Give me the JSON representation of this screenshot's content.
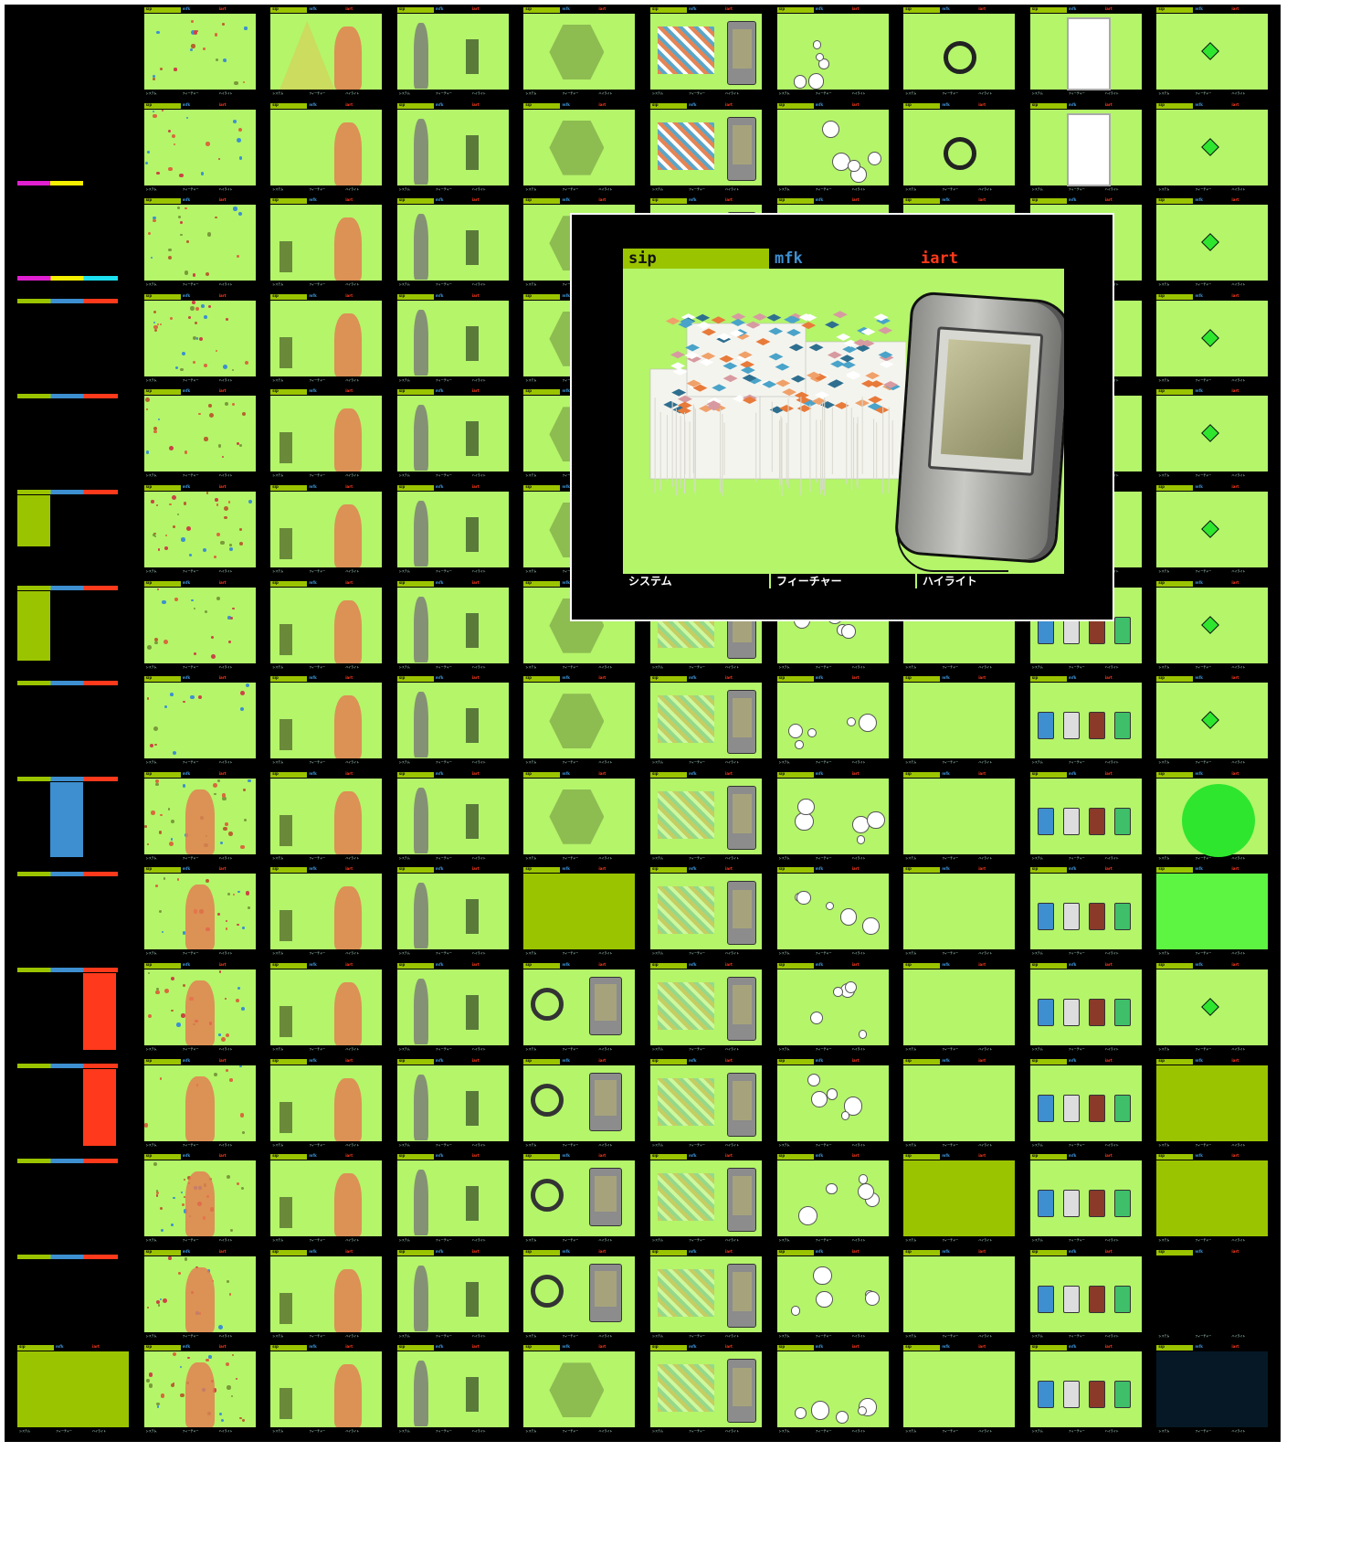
{
  "grid": {
    "columns": 10,
    "rows": 15
  },
  "thumb_header": {
    "sip": "sip",
    "mfk": "mfk",
    "iart": "iart"
  },
  "thumb_footer": {
    "system": "システム",
    "features": "フィーチャー",
    "highlight": "ハイライト"
  },
  "overlay": {
    "header": {
      "sip": "sip",
      "mfk": "mfk",
      "iart": "iart"
    },
    "footer": {
      "system": "システム",
      "features": "フィーチャー",
      "highlight": "ハイライト"
    }
  },
  "colors": {
    "screen_green": "#b4f56a",
    "sip_green": "#9bc400",
    "mfk_blue": "#3d8fd0",
    "iart_red": "#ff3a1c",
    "background": "#000000"
  }
}
